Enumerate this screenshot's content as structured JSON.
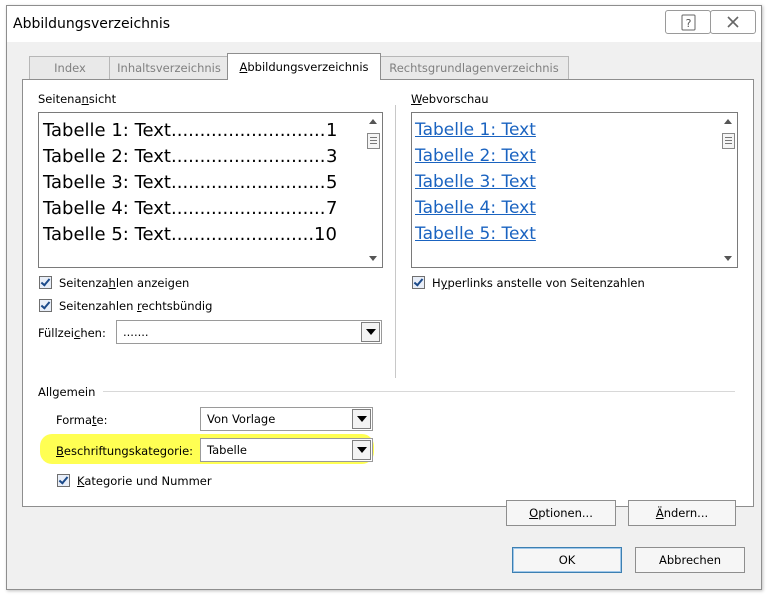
{
  "window": {
    "title": "Abbildungsverzeichnis",
    "help_glyph": "?",
    "close_glyph": "✕"
  },
  "tabs": [
    {
      "label": "Index"
    },
    {
      "label": "Inhaltsverzeichnis"
    },
    {
      "label": "Abbildungsverzeichnis",
      "active": true
    },
    {
      "label": "Rechtsgrundlagenverzeichnis"
    }
  ],
  "print_preview": {
    "label": "Seitenansicht",
    "entries": [
      {
        "text": "Tabelle 1: Text",
        "page": "1"
      },
      {
        "text": "Tabelle 2: Text",
        "page": "3"
      },
      {
        "text": "Tabelle 3: Text",
        "page": "5"
      },
      {
        "text": "Tabelle 4: Text",
        "page": "7"
      },
      {
        "text": "Tabelle 5: Text",
        "page": "10"
      }
    ],
    "leader": "............................................................"
  },
  "web_preview": {
    "label": "Webvorschau",
    "entries": [
      "Tabelle 1: Text",
      "Tabelle 2: Text",
      "Tabelle 3: Text",
      "Tabelle 4: Text",
      "Tabelle 5: Text"
    ]
  },
  "options": {
    "show_page_numbers": {
      "label": "Seitenzahlen anzeigen",
      "checked": true
    },
    "right_align": {
      "label": "Seitenzahlen rechtsbündig",
      "checked": true
    },
    "hyperlinks": {
      "label": "Hyperlinks anstelle von Seitenzahlen",
      "checked": true
    },
    "tab_leader": {
      "label": "Füllzeichen:",
      "value": "......."
    }
  },
  "general": {
    "label": "Allgemein",
    "formats": {
      "label": "Formate:",
      "value": "Von Vorlage"
    },
    "caption_label": {
      "label": "Beschriftungskategorie:",
      "value": "Tabelle"
    },
    "include_label": {
      "label": "Kategorie und Nummer",
      "checked": true
    }
  },
  "buttons": {
    "options": "Optionen...",
    "modify": "Ändern...",
    "ok": "OK",
    "cancel": "Abbrechen"
  },
  "colors": {
    "link": "#1a63c0",
    "highlight": "#ffff40"
  }
}
